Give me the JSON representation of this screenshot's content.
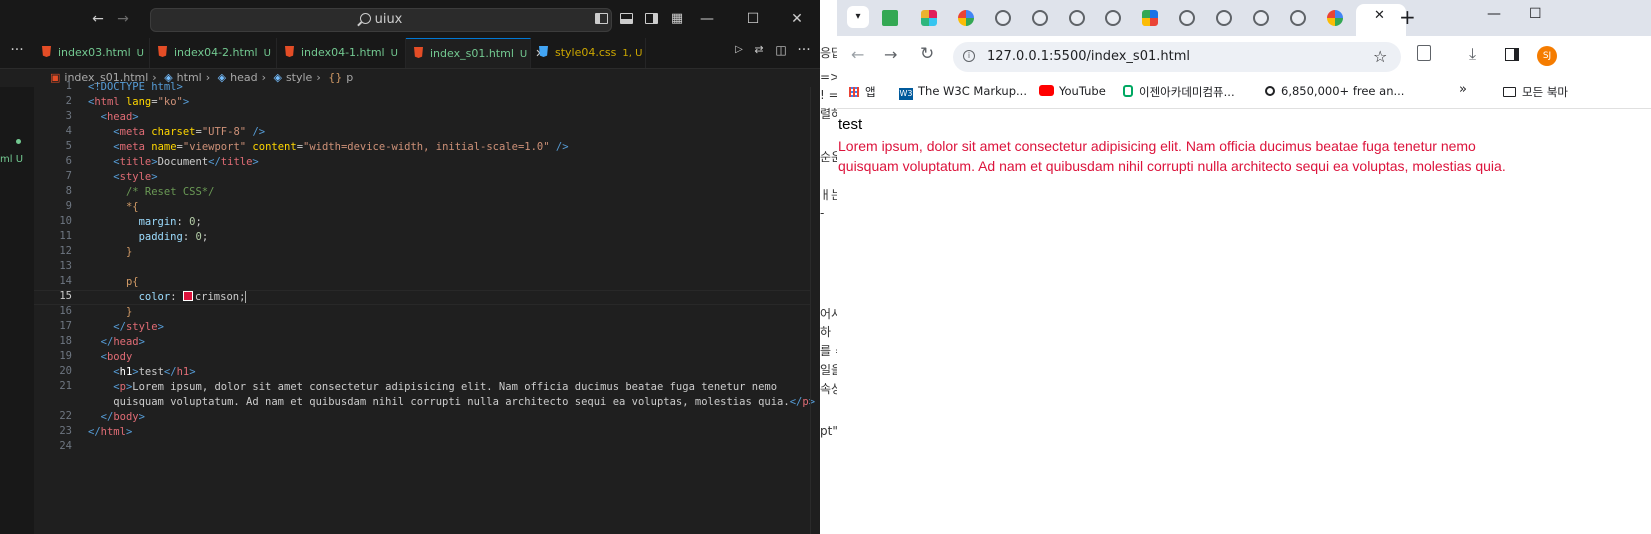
{
  "vscode": {
    "search_text": "uiux",
    "tabs": [
      {
        "label": "index03.html",
        "badge": "U"
      },
      {
        "label": "index04-2.html",
        "badge": "U"
      },
      {
        "label": "index04-1.html",
        "badge": "U"
      },
      {
        "label": "index_s01.html",
        "badge": "U",
        "close": "✕"
      },
      {
        "label": "style04.css",
        "badge": "1, U"
      }
    ],
    "breadcrumb": [
      "index_s01.html",
      "html",
      "head",
      "style",
      "p"
    ],
    "side_label": "ml U",
    "line_numbers": [
      "1",
      "2",
      "3",
      "4",
      "5",
      "6",
      "7",
      "8",
      "9",
      "10",
      "11",
      "12",
      "13",
      "14",
      "15",
      "16",
      "17",
      "18",
      "19",
      "20",
      "21",
      "22",
      "23",
      "24"
    ],
    "code": {
      "l1": "<!DOCTYPE html>",
      "l2_tag": "html",
      "l2_attr": "lang",
      "l2_val": "\"ko\"",
      "l3_tag": "head",
      "l4_tag": "meta",
      "l4_attr": "charset",
      "l4_val": "\"UTF-8\"",
      "l5_tag": "meta",
      "l5_attr1": "name",
      "l5_val1": "\"viewport\"",
      "l5_attr2": "content",
      "l5_val2": "\"width=device-width, initial-scale=1.0\"",
      "l6_tag": "title",
      "l6_text": "Document",
      "l7_tag": "style",
      "l8": "/* Reset CSS*/",
      "l9": "*{",
      "l10_prop": "margin",
      "l10_val": "0",
      "l11_prop": "padding",
      "l11_val": "0",
      "l12": "}",
      "l14": "p{",
      "l15_prop": "color",
      "l15_val": "crimson;",
      "l16": "}",
      "l17_tag": "style",
      "l18_tag": "head",
      "l19_tag": "body",
      "l20_tag": "h1",
      "l20_text": "test",
      "l21_tag": "p",
      "l21_text": "Lorem ipsum, dolor sit amet consectetur adipisicing elit. Nam officia ducimus beatae fuga tenetur nemo",
      "l21b_text": "quisquam voluptatum. Ad nam et quibusdam nihil corrupti nulla architecto sequi ea voluptas, molestias quia.",
      "l22_tag": "body",
      "l23_tag": "html"
    }
  },
  "strip": [
    "응답",
    "=>",
    "! =",
    "렬하",
    "순운",
    "ㅐ는",
    " -",
    "어시",
    " 하",
    "를 =",
    "일을",
    "속성",
    "pt\""
  ],
  "chrome": {
    "url": "127.0.0.1:5500/index_s01.html",
    "profile": "SJ",
    "bookmarks": [
      {
        "label": "앱"
      },
      {
        "label": "The W3C Markup..."
      },
      {
        "label": "YouTube"
      },
      {
        "label": "이젠아카데미컴퓨..."
      },
      {
        "label": "6,850,000+ free an..."
      },
      {
        "label": "모든 북마"
      }
    ],
    "page": {
      "h1": "test",
      "p": "Lorem ipsum, dolor sit amet consectetur adipisicing elit. Nam officia ducimus beatae fuga tenetur nemo quisquam voluptatum. Ad nam et quibusdam nihil corrupti nulla architecto sequi ea voluptas, molestias quia.",
      "p_line1": "Lorem ipsum, dolor sit amet consectetur adipisicing elit. Nam officia ducimus beatae fuga tenetur nemo",
      "p_line2": "quisquam voluptatum. Ad nam et quibusdam nihil corrupti nulla architecto sequi ea voluptas, molestias quia."
    }
  },
  "colors": {
    "crimson": "#dc143c",
    "vscode_bg": "#1f1f1f",
    "accent": "#0078d4"
  }
}
